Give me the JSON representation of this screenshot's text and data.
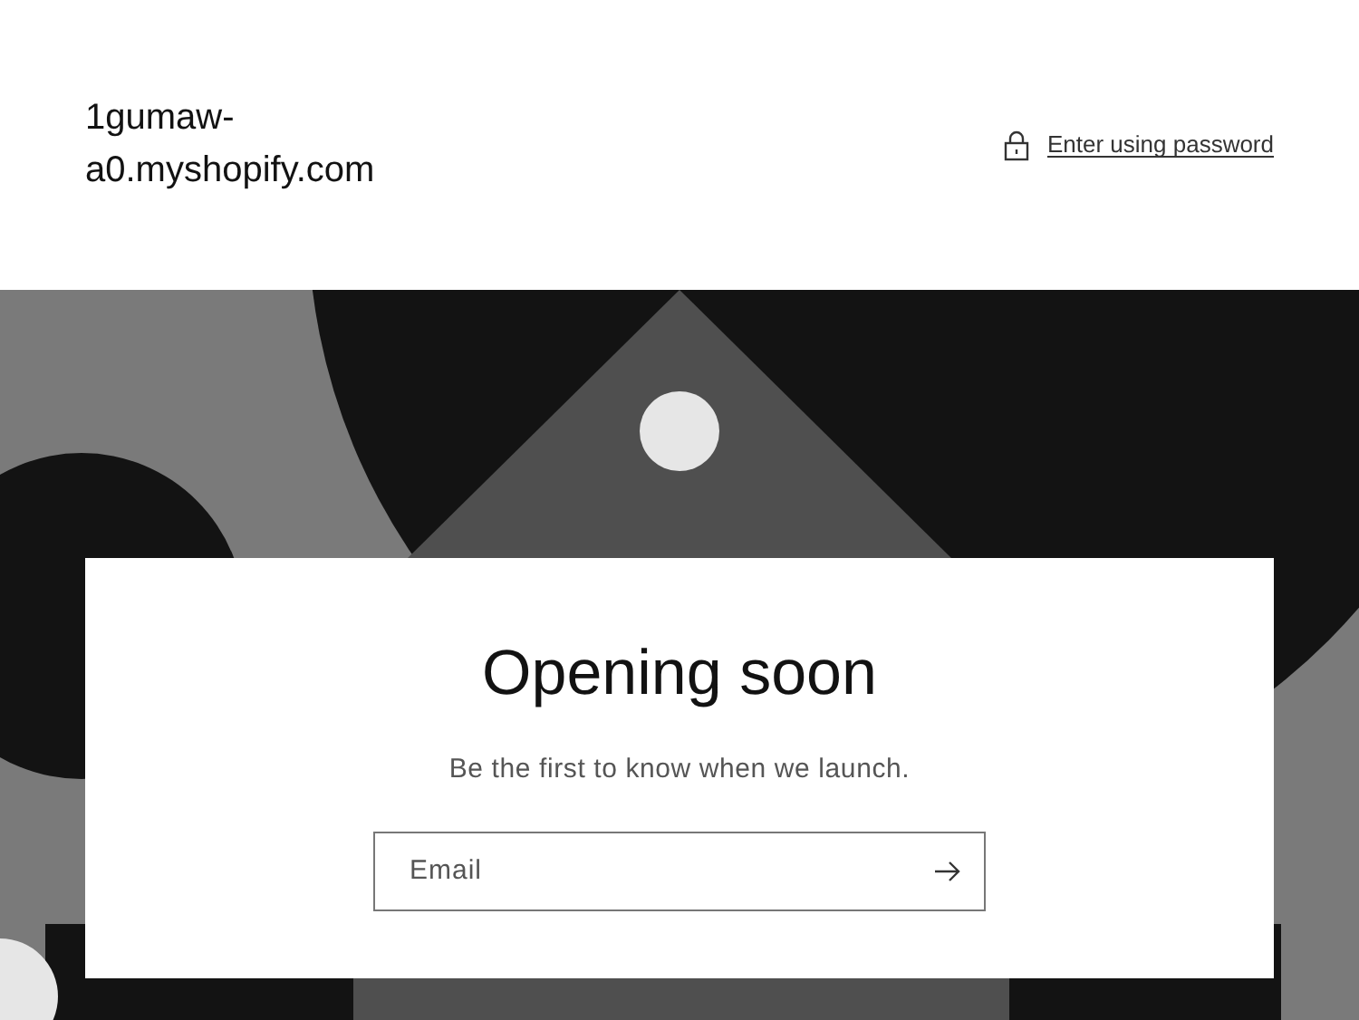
{
  "header": {
    "store_name": "1gumaw-a0.myshopify.com",
    "password_link": "Enter using password"
  },
  "card": {
    "title": "Opening soon",
    "subtitle": "Be the first to know when we launch.",
    "email": {
      "placeholder": "Email"
    }
  }
}
